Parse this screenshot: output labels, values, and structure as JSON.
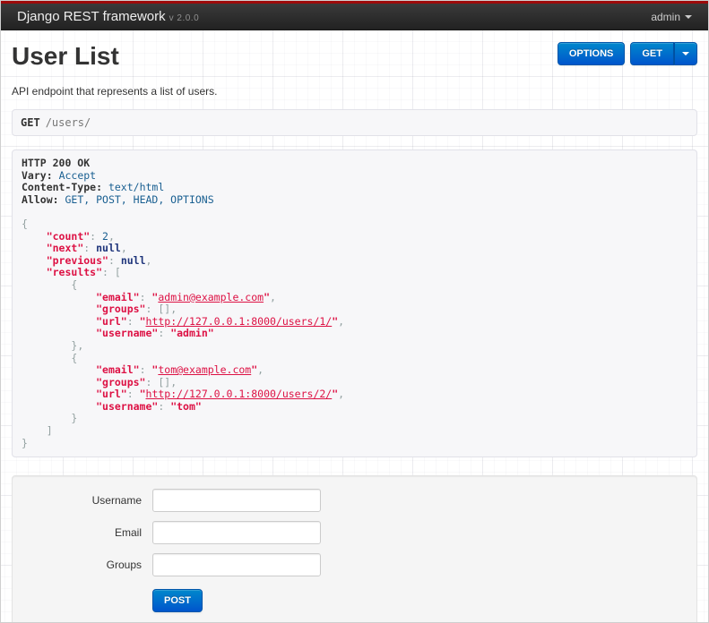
{
  "navbar": {
    "brand": "Django REST framework",
    "version": "v 2.0.0",
    "user_menu": "admin"
  },
  "header": {
    "title": "User List",
    "description": "API endpoint that represents a list of users."
  },
  "toolbar": {
    "options_label": "OPTIONS",
    "get_label": "GET"
  },
  "request": {
    "method": "GET",
    "path": "/users/"
  },
  "response": {
    "status_line": "HTTP 200 OK",
    "headers": [
      {
        "name": "Vary",
        "value": "Accept"
      },
      {
        "name": "Content-Type",
        "value": "text/html"
      },
      {
        "name": "Allow",
        "value": "GET, POST, HEAD, OPTIONS"
      }
    ],
    "body": {
      "count": 2,
      "next": null,
      "previous": null,
      "results": [
        {
          "email": "admin@example.com",
          "groups": [],
          "url": "http://127.0.0.1:8000/users/1/",
          "username": "admin"
        },
        {
          "email": "tom@example.com",
          "groups": [],
          "url": "http://127.0.0.1:8000/users/2/",
          "username": "tom"
        }
      ]
    }
  },
  "form": {
    "fields": [
      {
        "label": "Username",
        "value": "",
        "placeholder": ""
      },
      {
        "label": "Email",
        "value": "",
        "placeholder": ""
      },
      {
        "label": "Groups",
        "value": "",
        "placeholder": ""
      }
    ],
    "submit_label": "POST"
  },
  "icons": {
    "user_dropdown_caret": "caret-down",
    "get_dropdown_caret": "caret-down"
  },
  "colors": {
    "top_stripe_red": "#9d0a0a",
    "navbar_dark": "#2b2b2b",
    "button_blue_top": "#0088cc",
    "button_blue_bottom": "#0055cc",
    "code_string": "#dd1144",
    "code_keyword": "#1e347b",
    "code_literal": "#195f91",
    "code_punctuation": "#93a1a1",
    "code_plain": "#333333"
  }
}
